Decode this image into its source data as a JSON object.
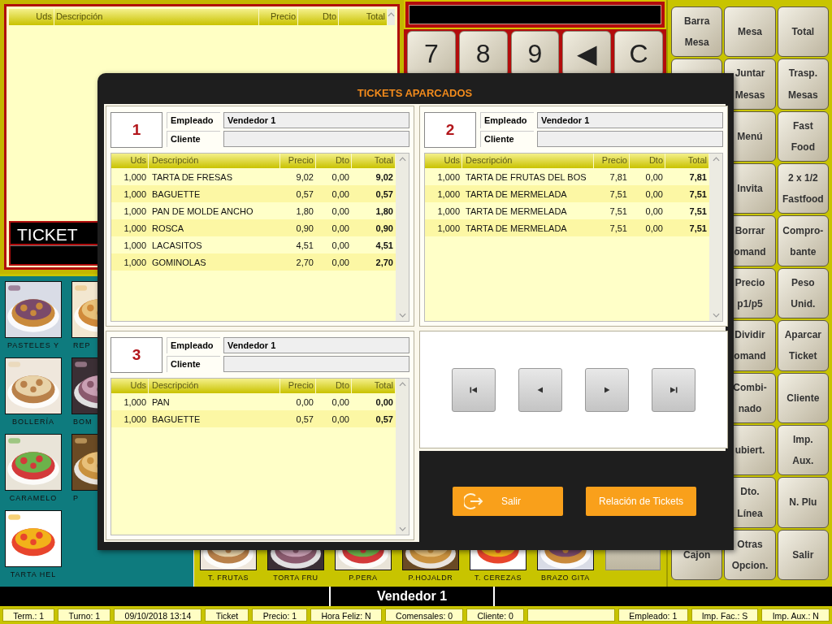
{
  "ticket_list": {
    "columns": [
      "Uds",
      "Descripción",
      "Precio",
      "Dto",
      "Total"
    ],
    "label": "TICKET"
  },
  "keypad": [
    "7",
    "8",
    "9",
    "◀",
    "C"
  ],
  "categories": [
    {
      "label": "PASTELES Y"
    },
    {
      "label": "REP"
    },
    {
      "label": "BOLLERÍA"
    },
    {
      "label": "BOM"
    },
    {
      "label": "CARAMELO"
    },
    {
      "label": "P"
    },
    {
      "label": "TARTA HEL"
    }
  ],
  "products": [
    {
      "label": "T. FRUTAS"
    },
    {
      "label": "TORTA FRU"
    },
    {
      "label": "P.PERA"
    },
    {
      "label": "P.HOJALDR"
    },
    {
      "label": "T. CEREZAS"
    },
    {
      "label": "BRAZO GITA"
    },
    {
      "kind": "blank"
    }
  ],
  "function_buttons": [
    [
      {
        "lines": [
          "Barra",
          "Mesa"
        ]
      },
      {
        "lines": [
          "Cajon"
        ]
      }
    ],
    [
      {
        "lines": [
          "Mesa"
        ]
      },
      {
        "lines": [
          "Juntar",
          "Mesas"
        ]
      },
      {
        "lines": [
          "Menú"
        ]
      },
      {
        "lines": [
          "Invita"
        ]
      },
      {
        "lines": [
          "Borrar",
          "omand"
        ]
      },
      {
        "lines": [
          "Precio",
          "p1/p5"
        ]
      },
      {
        "lines": [
          "Dividir",
          "omand"
        ]
      },
      {
        "lines": [
          "Combi-",
          "nado"
        ]
      },
      {
        "lines": [
          "ubiert."
        ]
      },
      {
        "lines": [
          "Dto.",
          "Línea"
        ]
      },
      {
        "lines": [
          "Otras",
          "Opcion."
        ]
      }
    ],
    [
      {
        "lines": [
          "Total"
        ]
      },
      {
        "lines": [
          "Trasp.",
          "Mesas"
        ]
      },
      {
        "lines": [
          "Fast",
          "Food"
        ]
      },
      {
        "lines": [
          "2 x 1/2",
          "Fastfood"
        ]
      },
      {
        "lines": [
          "Compro-",
          "bante"
        ]
      },
      {
        "lines": [
          "Peso",
          "Unid."
        ]
      },
      {
        "lines": [
          "Aparcar",
          "Ticket"
        ]
      },
      {
        "lines": [
          "Cliente"
        ]
      },
      {
        "lines": [
          "Imp.",
          "Aux."
        ]
      },
      {
        "lines": [
          "N. Plu"
        ]
      },
      {
        "lines": [
          "Salir"
        ]
      }
    ]
  ],
  "operator": "Vendedor 1",
  "status_bar": [
    {
      "text": "Term.: 1"
    },
    {
      "text": "Turno: 1"
    },
    {
      "text": "09/10/2018 13:14"
    },
    {
      "text": "Ticket"
    },
    {
      "text": "Precio: 1"
    },
    {
      "text": "Hora Feliz: N"
    },
    {
      "text": "Comensales: 0"
    },
    {
      "text": "Cliente: 0"
    },
    {
      "kind": "blank"
    },
    {
      "text": "Empleado: 1"
    },
    {
      "text": "Imp. Fac.: S"
    },
    {
      "text": "Imp. Aux.: N"
    }
  ],
  "dialog": {
    "title": "TICKETS APARCADOS",
    "tickets": [
      {
        "number": "1",
        "employee_label": "Empleado",
        "employee": "Vendedor 1",
        "client_label": "Cliente",
        "columns": [
          "Uds",
          "Descripción",
          "Precio",
          "Dto",
          "Total"
        ],
        "rows": [
          {
            "uds": "1,000",
            "description": "TARTA DE FRESAS",
            "price": "9,02",
            "discount": "0,00",
            "total": "9,02"
          },
          {
            "uds": "1,000",
            "description": "BAGUETTE",
            "price": "0,57",
            "discount": "0,00",
            "total": "0,57"
          },
          {
            "uds": "1,000",
            "description": "PAN DE MOLDE ANCHO",
            "price": "1,80",
            "discount": "0,00",
            "total": "1,80"
          },
          {
            "uds": "1,000",
            "description": "ROSCA",
            "price": "0,90",
            "discount": "0,00",
            "total": "0,90"
          },
          {
            "uds": "1,000",
            "description": "LACASITOS",
            "price": "4,51",
            "discount": "0,00",
            "total": "4,51"
          },
          {
            "uds": "1,000",
            "description": "GOMINOLAS",
            "price": "2,70",
            "discount": "0,00",
            "total": "2,70"
          }
        ]
      },
      {
        "number": "2",
        "employee_label": "Empleado",
        "employee": "Vendedor 1",
        "client_label": "Cliente",
        "columns": [
          "Uds",
          "Descripción",
          "Precio",
          "Dto",
          "Total"
        ],
        "rows": [
          {
            "uds": "1,000",
            "description": "TARTA DE FRUTAS DEL BOS",
            "price": "7,81",
            "discount": "0,00",
            "total": "7,81"
          },
          {
            "uds": "1,000",
            "description": "TARTA DE MERMELADA",
            "price": "7,51",
            "discount": "0,00",
            "total": "7,51"
          },
          {
            "uds": "1,000",
            "description": "TARTA DE MERMELADA",
            "price": "7,51",
            "discount": "0,00",
            "total": "7,51"
          },
          {
            "uds": "1,000",
            "description": "TARTA DE MERMELADA",
            "price": "7,51",
            "discount": "0,00",
            "total": "7,51"
          }
        ]
      },
      {
        "number": "3",
        "employee_label": "Empleado",
        "employee": "Vendedor 1",
        "client_label": "Cliente",
        "columns": [
          "Uds",
          "Descripción",
          "Precio",
          "Dto",
          "Total"
        ],
        "rows": [
          {
            "uds": "1,000",
            "description": "PAN",
            "price": "0,00",
            "discount": "0,00",
            "total": "0,00"
          },
          {
            "uds": "1,000",
            "description": "BAGUETTE",
            "price": "0,57",
            "discount": "0,00",
            "total": "0,57"
          }
        ]
      }
    ],
    "buttons": [
      {
        "kind": "exit",
        "label": "Salir"
      },
      {
        "kind": "plain",
        "label": "Relación de Tickets"
      }
    ]
  }
}
